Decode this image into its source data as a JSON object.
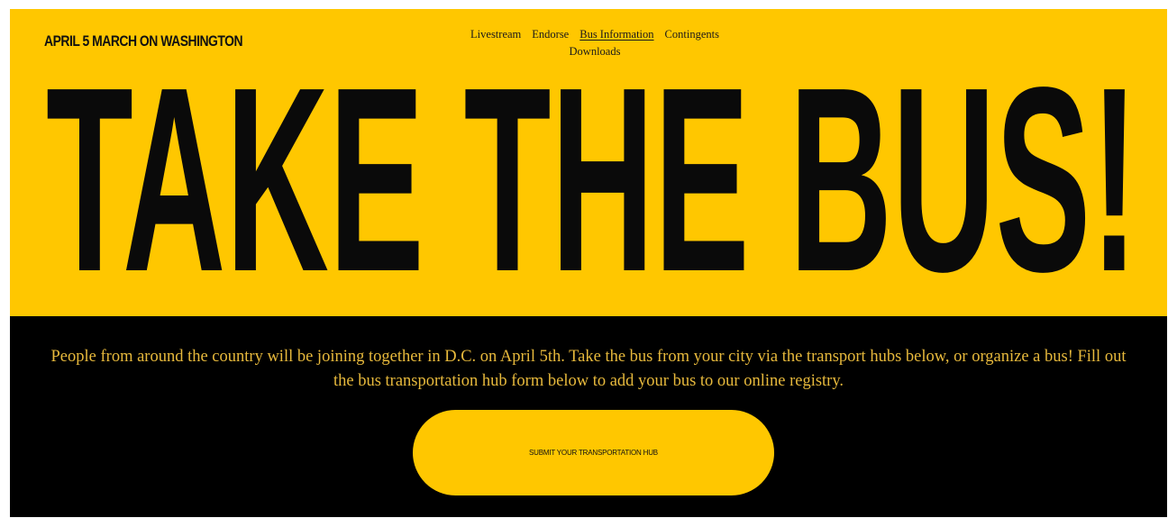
{
  "header": {
    "brand": "APRIL 5 MARCH ON WASHINGTON",
    "nav": [
      {
        "label": "Livestream",
        "active": false
      },
      {
        "label": "Endorse",
        "active": false
      },
      {
        "label": "Bus Information",
        "active": true
      },
      {
        "label": "Contingents",
        "active": false
      },
      {
        "label": "Downloads",
        "active": false
      }
    ]
  },
  "hero": {
    "headline": "TAKE THE BUS!"
  },
  "body": {
    "intro": "People from around the country will be joining together in D.C. on April 5th. Take the bus from your city via the transport hubs below, or organize a bus! Fill out the bus transportation hub form below to add your bus to our online registry.",
    "cta_label": "SUBMIT YOUR TRANSPORTATION HUB"
  },
  "colors": {
    "hero_background": "#ffc700",
    "dark_background": "#000000",
    "intro_text": "#e7b93c",
    "headline_text": "#0a0a0a"
  }
}
